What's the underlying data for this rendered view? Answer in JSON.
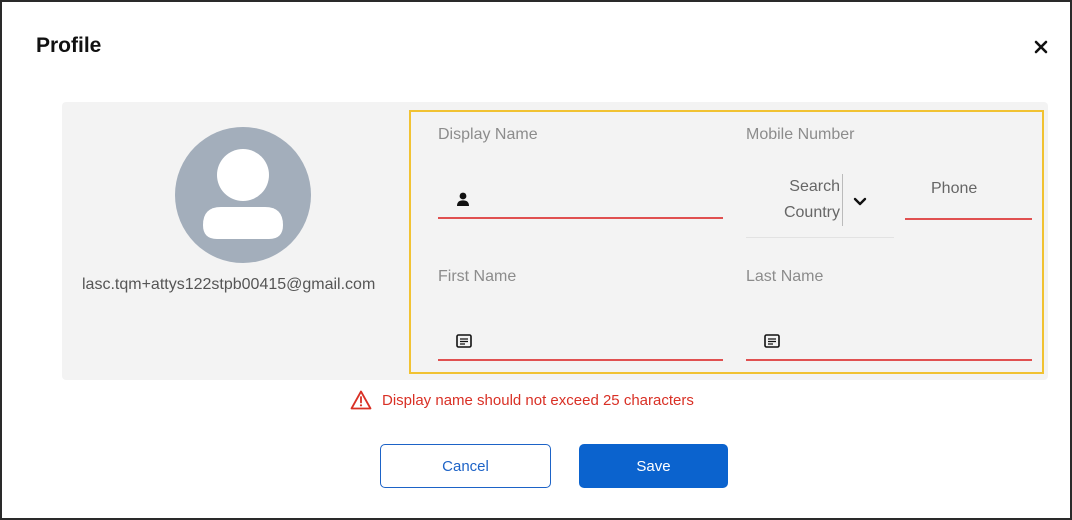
{
  "dialog": {
    "title": "Profile",
    "close_icon": "close-icon"
  },
  "profile": {
    "avatar_icon": "user-avatar-icon",
    "email": "lasc.tqm+attys122stpb00415@gmail.com"
  },
  "form": {
    "display_name": {
      "label": "Display Name",
      "value": "",
      "icon": "person-icon"
    },
    "mobile_number": {
      "label": "Mobile Number",
      "country_placeholder_line1": "Search",
      "country_placeholder_line2": "Country",
      "phone_placeholder": "Phone"
    },
    "first_name": {
      "label": "First Name",
      "value": "",
      "icon": "text-field-icon"
    },
    "last_name": {
      "label": "Last Name",
      "value": "",
      "icon": "text-field-icon"
    }
  },
  "error": {
    "message": "Display name should not exceed 25 characters",
    "icon": "warning-icon"
  },
  "buttons": {
    "cancel": "Cancel",
    "save": "Save"
  },
  "colors": {
    "accent": "#0b63ce",
    "error": "#d93025",
    "field_underline": "#e05050",
    "focus_border": "#f1c232",
    "avatar": "#a3aebb"
  }
}
